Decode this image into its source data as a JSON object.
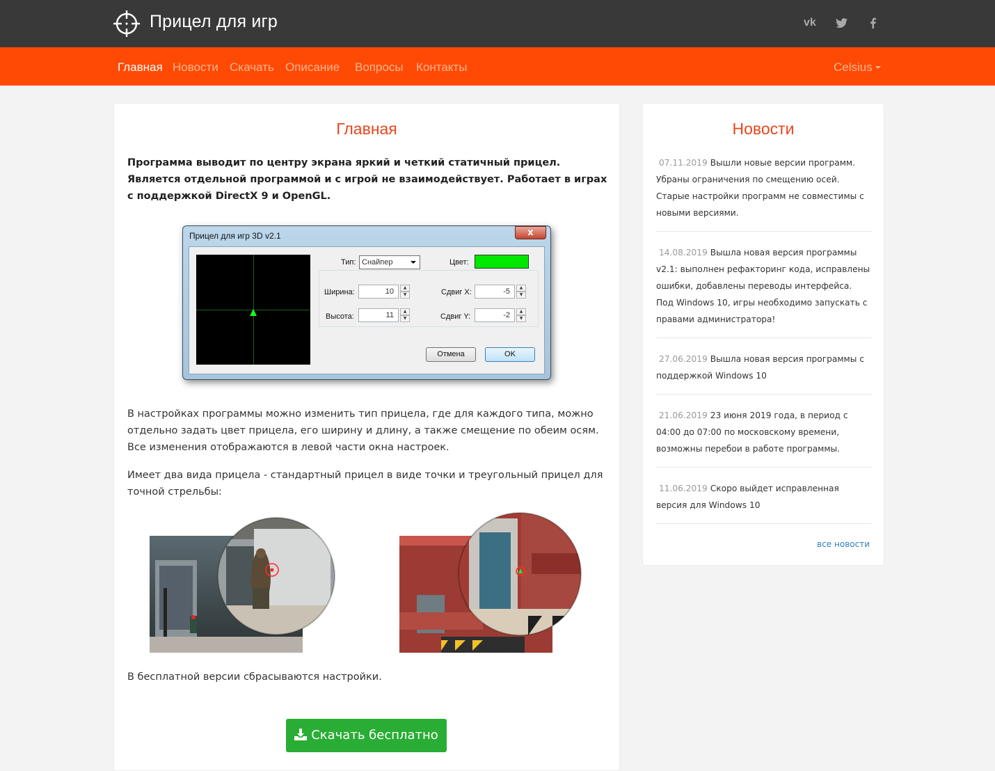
{
  "header": {
    "brand": "Прицел для игр",
    "social": [
      "vk-icon",
      "twitter-icon",
      "facebook-icon"
    ]
  },
  "nav": {
    "items": [
      "Главная",
      "Новости",
      "Скачать",
      "Описание",
      "Вопросы",
      "Контакты"
    ],
    "active": "Главная",
    "user": "Celsius"
  },
  "main": {
    "title": "Главная",
    "intro": "Программа выводит по центру экрана яркий и четкий статичный прицел. Является отдельной программой и с игрой не взаимодействует. Работает в играх с поддержкой DirectX 9 и OpenGL.",
    "para1": "В настройках программы можно изменить тип прицела, где для каждого типа, можно отдельно задать цвет прицела, его ширину и длину, а также смещение по обеим осям. Все изменения отображаются в левой части окна настроек.",
    "para2": "Имеет два вида прицела - стандартный прицел в виде точки и треугольный прицел для точной стрельбы:",
    "para3": "В бесплатной версии сбрасываются настройки.",
    "download_label": "Скачать бесплатно"
  },
  "dialog": {
    "title": "Прицел для игр 3D v2.1",
    "close": "x",
    "type_label": "Тип:",
    "type_value": "Снайпер",
    "color_label": "Цвет:",
    "color_value": "#00e800",
    "width_label": "Ширина:",
    "width_value": "10",
    "height_label": "Высота:",
    "height_value": "11",
    "shift_x_label": "Сдвиг X:",
    "shift_x_value": "-5",
    "shift_y_label": "Сдвиг Y:",
    "shift_y_value": "-2",
    "cancel": "Отмена",
    "ok": "OK"
  },
  "news": {
    "title": "Новости",
    "items": [
      {
        "date": "07.11.2019",
        "text": "Вышли новые версии программ. Убраны ограничения по смещению осей. Старые настройки программ не совместимы с новыми версиями."
      },
      {
        "date": "14.08.2019",
        "text": "Вышла новая версия программы v2.1: выполнен рефакторинг кода, исправлены ошибки, добавлены переводы интерфейса. Под Windows 10, игры необходимо запускать с правами администратора!"
      },
      {
        "date": "27.06.2019",
        "text": "Вышла новая версия программы с поддержкой Windows 10"
      },
      {
        "date": "21.06.2019",
        "text": "23 июня 2019 года, в период с 04:00 до 07:00 по московскому времени, возможны перебои в работе программы."
      },
      {
        "date": "11.06.2019",
        "text": "Скоро выйдет исправленная версия для Windows 10"
      }
    ],
    "all_link": "все новости"
  },
  "colors": {
    "topbar": "#393939",
    "accent": "#ff4a05",
    "heading": "#e8461c",
    "download": "#2aad34",
    "link": "#2f7fc4"
  }
}
